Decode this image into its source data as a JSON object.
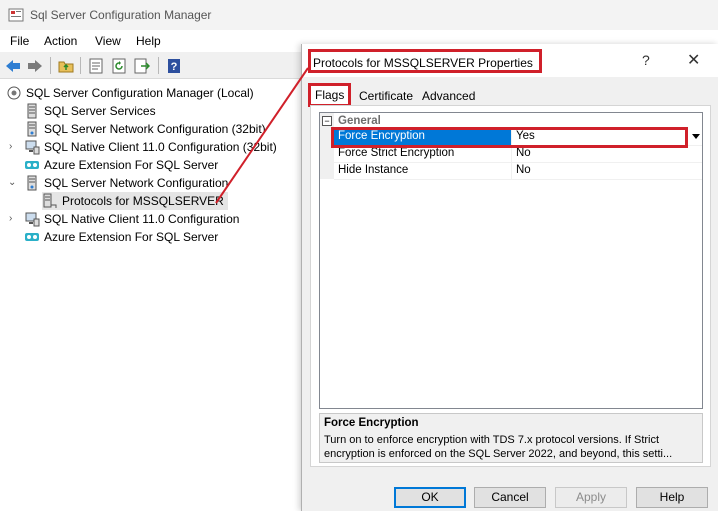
{
  "window": {
    "title": "Sql Server Configuration Manager",
    "menu": [
      "File",
      "Action",
      "View",
      "Help"
    ]
  },
  "tree": {
    "root": "SQL Server Configuration Manager (Local)",
    "items": [
      "SQL Server Services",
      "SQL Server Network Configuration (32bit)",
      "SQL Native Client 11.0 Configuration (32bit)",
      "Azure Extension For SQL Server",
      "SQL Server Network Configuration",
      "Protocols for MSSQLSERVER",
      "SQL Native Client 11.0 Configuration",
      "Azure Extension For SQL Server"
    ]
  },
  "dialog": {
    "title": "Protocols for MSSQLSERVER Properties",
    "help_glyph": "?",
    "close_glyph": "✕",
    "tabs": [
      "Flags",
      "Certificate",
      "Advanced"
    ],
    "category": "General",
    "category_toggle": "−",
    "properties": [
      {
        "name": "Force Encryption",
        "value": "Yes"
      },
      {
        "name": "Force Strict Encryption",
        "value": "No"
      },
      {
        "name": "Hide Instance",
        "value": "No"
      }
    ],
    "description_title": "Force Encryption",
    "description_text": "Turn on to enforce encryption with TDS 7.x protocol versions. If Strict encryption is enforced on the SQL Server 2022, and beyond, this setti...",
    "buttons": {
      "ok": "OK",
      "cancel": "Cancel",
      "apply": "Apply",
      "help": "Help"
    }
  },
  "colors": {
    "highlight": "#d0202a",
    "selection": "#0078d7"
  }
}
